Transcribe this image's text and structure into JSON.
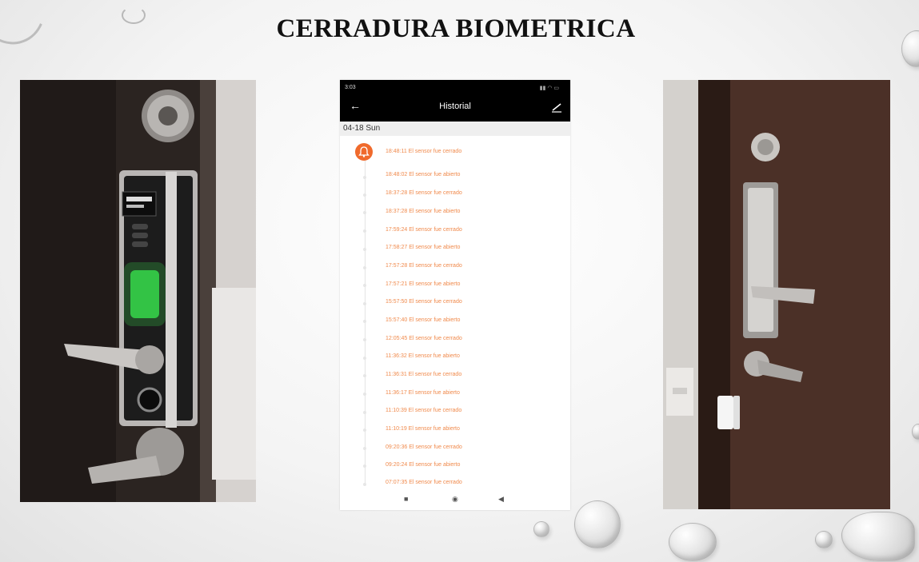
{
  "slide": {
    "title": "CERRADURA BIOMETRICA"
  },
  "phone": {
    "status_time": "3:03",
    "header_title": "Historial",
    "date": "04-18 Sun",
    "events": [
      "18:48:11 El sensor fue cerrado",
      "18:48:02 El sensor fue abierto",
      "18:37:28 El sensor fue cerrado",
      "18:37:28 El sensor fue abierto",
      "17:59:24 El sensor fue cerrado",
      "17:58:27 El sensor fue abierto",
      "17:57:28 El sensor fue cerrado",
      "17:57:21 El sensor fue abierto",
      "15:57:50 El sensor fue cerrado",
      "15:57:40 El sensor fue abierto",
      "12:05:45 El sensor fue cerrado",
      "11:36:32 El sensor fue abierto",
      "11:36:31 El sensor fue cerrado",
      "11:36:17 El sensor fue abierto",
      "11:10:39 El sensor fue cerrado",
      "11:10:19 El sensor fue abierto",
      "09:20:36 El sensor fue cerrado",
      "09:20:24 El sensor fue abierto",
      "07:07:35 El sensor fue cerrado"
    ],
    "icons": {
      "back": "back-arrow-icon",
      "edit": "edit-icon",
      "event": "bell-icon",
      "nav": [
        "square-nav-icon",
        "circle-nav-icon",
        "triangle-back-icon"
      ]
    },
    "colors": {
      "accent": "#f06a2c",
      "event_text": "#f08a4c",
      "header_bg": "#000000"
    }
  }
}
